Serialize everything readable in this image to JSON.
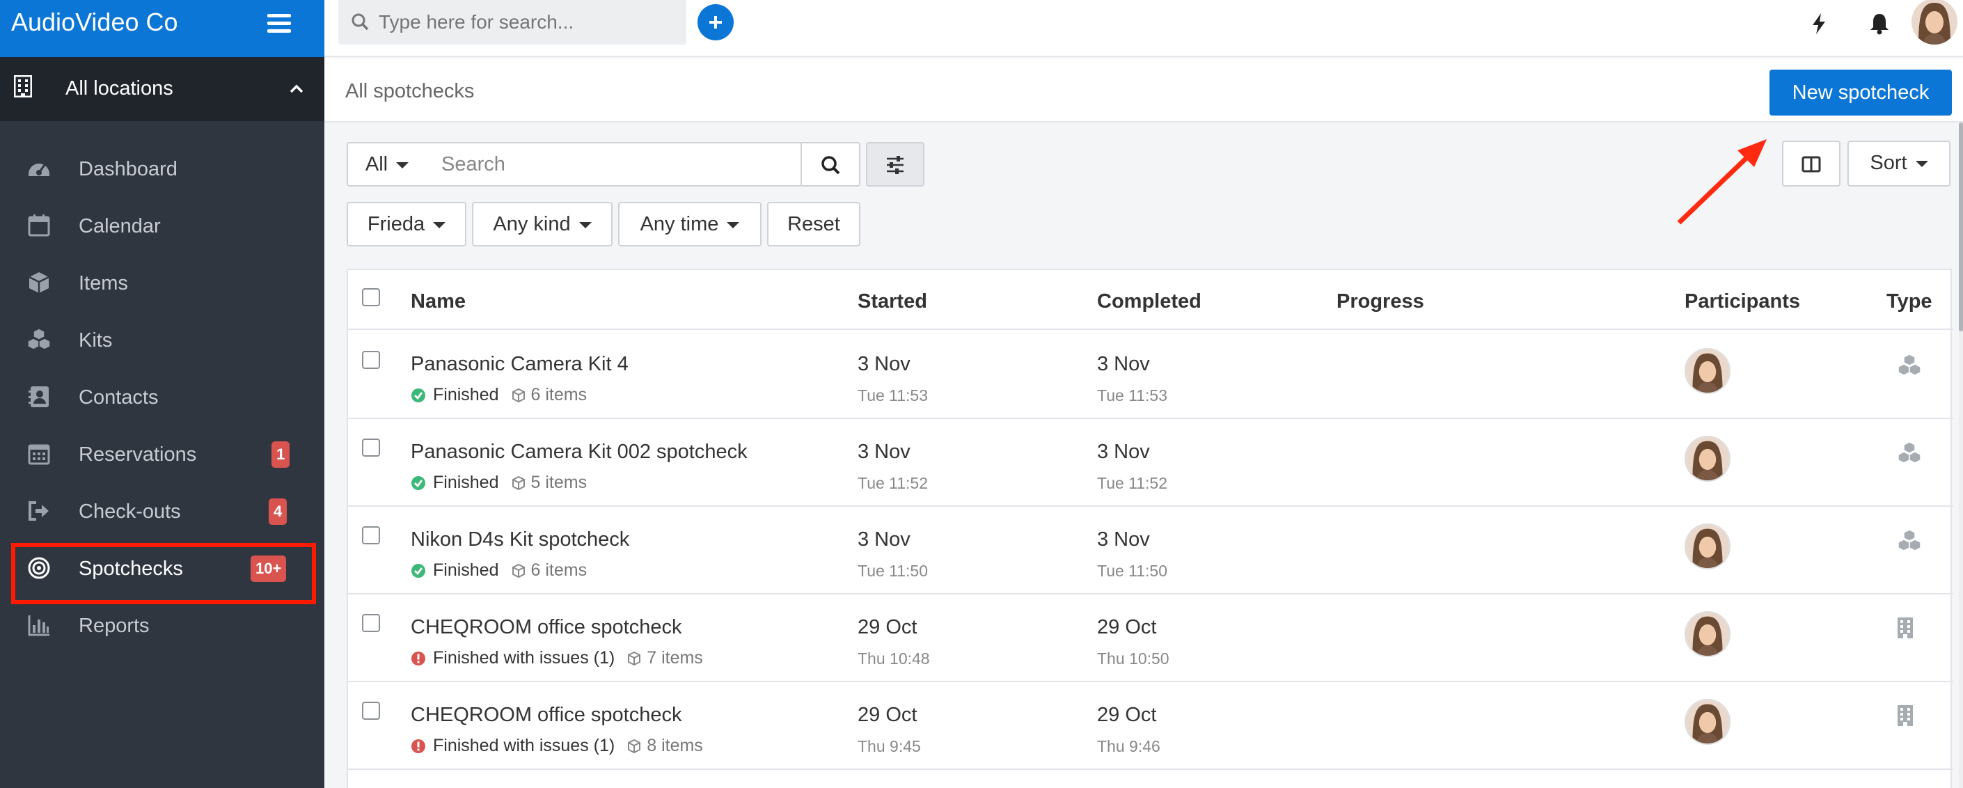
{
  "sidebar": {
    "brand": "AudioVideo Co",
    "location": "All locations",
    "items": [
      {
        "label": "Dashboard",
        "icon": "dashboard-icon"
      },
      {
        "label": "Calendar",
        "icon": "calendar-icon"
      },
      {
        "label": "Items",
        "icon": "box-icon"
      },
      {
        "label": "Kits",
        "icon": "kits-icon"
      },
      {
        "label": "Contacts",
        "icon": "contact-icon"
      },
      {
        "label": "Reservations",
        "icon": "calendar-grid-icon",
        "badge": "1"
      },
      {
        "label": "Check-outs",
        "icon": "sign-out-icon",
        "badge": "4"
      },
      {
        "label": "Spotchecks",
        "icon": "target-icon",
        "badge": "10+",
        "active": true
      },
      {
        "label": "Reports",
        "icon": "bar-chart-icon"
      }
    ]
  },
  "topbar": {
    "search_placeholder": "Type here for search..."
  },
  "page": {
    "breadcrumb": "All spotchecks",
    "new_button": "New spotcheck"
  },
  "filters": {
    "all_label": "All",
    "search_placeholder": "Search",
    "sort_label": "Sort",
    "person": "Frieda",
    "kind": "Any kind",
    "time": "Any time",
    "reset": "Reset"
  },
  "table": {
    "headers": {
      "name": "Name",
      "started": "Started",
      "completed": "Completed",
      "progress": "Progress",
      "participants": "Participants",
      "type": "Type"
    },
    "rows": [
      {
        "name": "Panasonic Camera Kit 4",
        "status": "Finished",
        "status_kind": "ok",
        "items": "6 items",
        "started_date": "3 Nov",
        "started_time": "Tue 11:53",
        "completed_date": "3 Nov",
        "completed_time": "Tue 11:53",
        "type_icon": "kits-icon"
      },
      {
        "name": "Panasonic Camera Kit 002 spotcheck",
        "status": "Finished",
        "status_kind": "ok",
        "items": "5 items",
        "started_date": "3 Nov",
        "started_time": "Tue 11:52",
        "completed_date": "3 Nov",
        "completed_time": "Tue 11:52",
        "type_icon": "kits-icon"
      },
      {
        "name": "Nikon D4s Kit spotcheck",
        "status": "Finished",
        "status_kind": "ok",
        "items": "6 items",
        "started_date": "3 Nov",
        "started_time": "Tue 11:50",
        "completed_date": "3 Nov",
        "completed_time": "Tue 11:50",
        "type_icon": "kits-icon"
      },
      {
        "name": "CHEQROOM office spotcheck",
        "status": "Finished with issues (1)",
        "status_kind": "issue",
        "items": "7 items",
        "started_date": "29 Oct",
        "started_time": "Thu 10:48",
        "completed_date": "29 Oct",
        "completed_time": "Thu 10:50",
        "type_icon": "building-icon"
      },
      {
        "name": "CHEQROOM office spotcheck",
        "status": "Finished with issues (1)",
        "status_kind": "issue",
        "items": "8 items",
        "started_date": "29 Oct",
        "started_time": "Thu 9:45",
        "completed_date": "29 Oct",
        "completed_time": "Thu 9:46",
        "type_icon": "building-icon"
      }
    ]
  },
  "colors": {
    "brand": "#0b76d6",
    "sidebar": "#2f3640",
    "badge": "#d9534f",
    "ok": "#3cb878",
    "issue": "#d9534f",
    "highlight": "#ff1a00"
  }
}
